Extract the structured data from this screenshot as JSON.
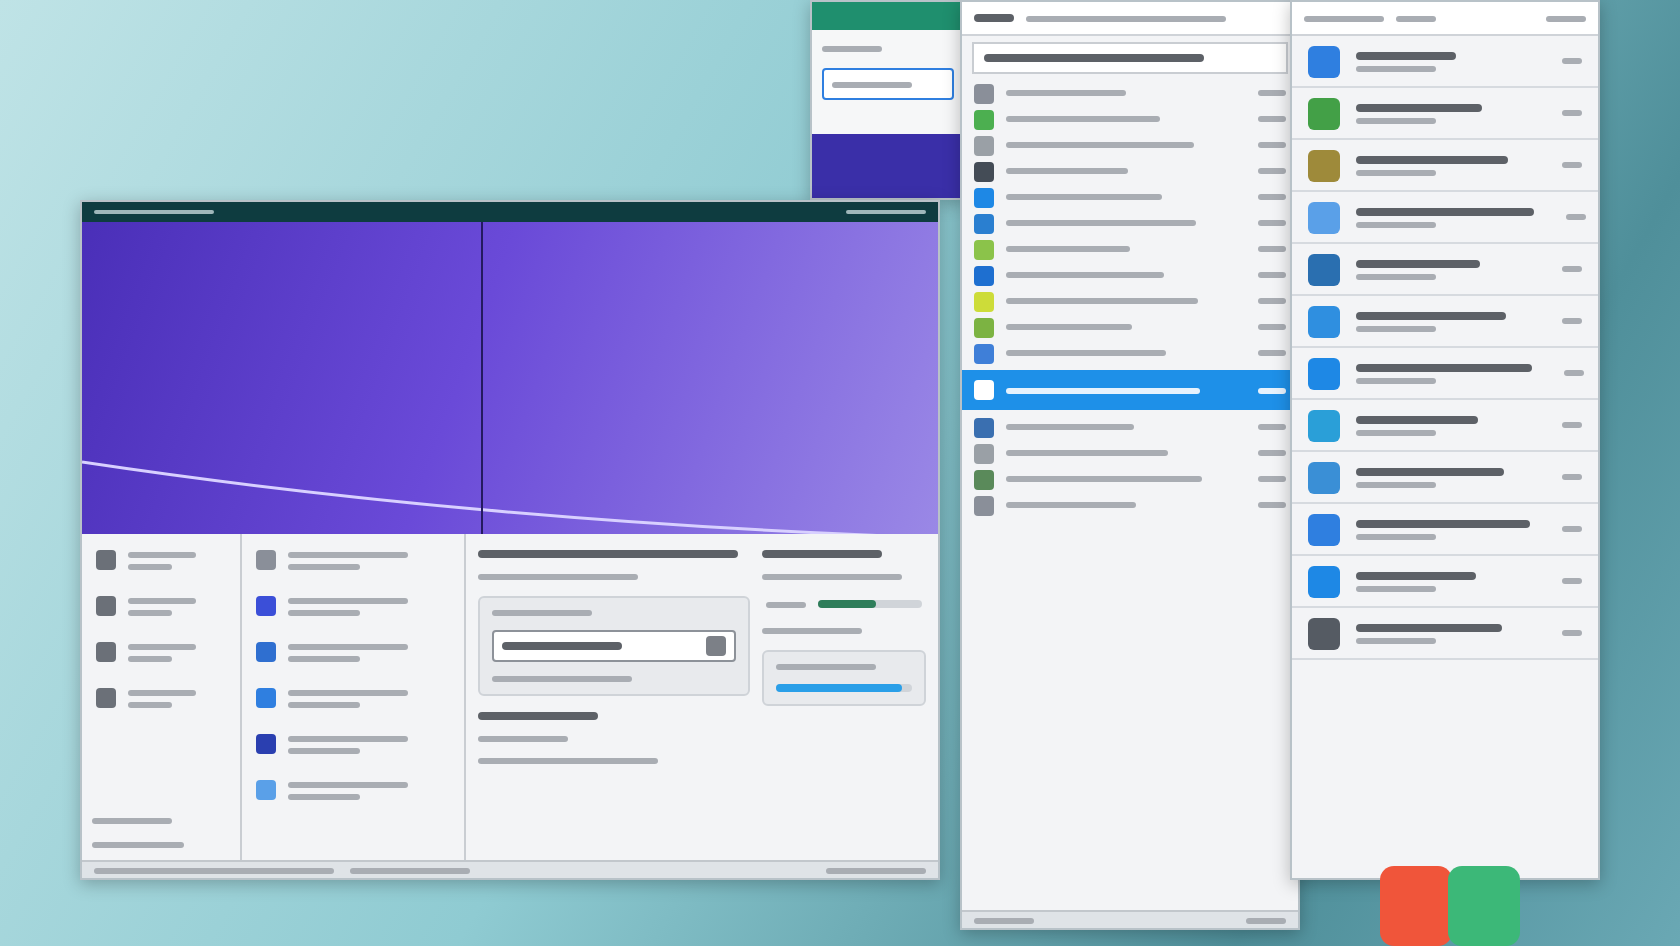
{
  "media_window": {
    "sidebar_items": [
      {
        "selected": false
      },
      {
        "selected": false
      },
      {
        "selected": false
      },
      {
        "selected": false
      }
    ],
    "list_items": [
      {
        "selected": false,
        "color": "#8a8f99"
      },
      {
        "selected": false,
        "color": "#3b4fd8"
      },
      {
        "selected": false,
        "color": "#2f6fd0"
      },
      {
        "selected": false,
        "color": "#2f7fe0"
      },
      {
        "selected": false,
        "color": "#2a3fb0"
      },
      {
        "selected": false,
        "color": "#5aa0e8"
      }
    ],
    "slider": {
      "level": 0.55
    },
    "progress": {
      "level": 0.92
    }
  },
  "menu_window": {
    "rows": [
      {
        "selected": false,
        "color": "#8a8f99"
      },
      {
        "selected": false,
        "color": "#4caf50"
      },
      {
        "selected": false,
        "color": "#9aa0a6"
      },
      {
        "selected": false,
        "color": "#444c56"
      },
      {
        "selected": false,
        "color": "#1e88e5"
      },
      {
        "selected": false,
        "color": "#2a7fd0"
      },
      {
        "selected": false,
        "color": "#8bc34a"
      },
      {
        "selected": false,
        "color": "#1e6fd0"
      },
      {
        "selected": false,
        "color": "#cddc39"
      },
      {
        "selected": false,
        "color": "#7cb342"
      },
      {
        "selected": false,
        "color": "#3f7fd8"
      },
      {
        "selected": true,
        "color": "#ffffff"
      },
      {
        "selected": false,
        "color": "#3a6fb0"
      },
      {
        "selected": false,
        "color": "#9aa0a6"
      },
      {
        "selected": false,
        "color": "#5a8a5a"
      },
      {
        "selected": false,
        "color": "#8a8f99"
      }
    ]
  },
  "side_panel": {
    "cards": [
      {
        "color": "#2f7fe0"
      },
      {
        "color": "#43a047"
      },
      {
        "color": "#9e8a3a"
      },
      {
        "color": "#5aa0e8"
      },
      {
        "color": "#2a6fb0"
      },
      {
        "color": "#2f8fe0"
      },
      {
        "color": "#1e88e5"
      },
      {
        "color": "#2a9fd8"
      },
      {
        "color": "#3a8fd6"
      },
      {
        "color": "#2f7fe0"
      },
      {
        "color": "#1e88e5"
      },
      {
        "color": "#555b63"
      }
    ]
  }
}
